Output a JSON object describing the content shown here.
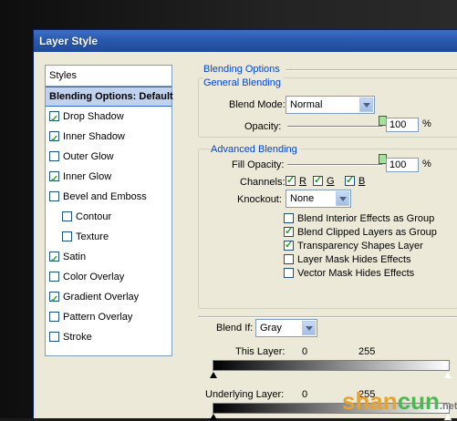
{
  "window": {
    "title": "Layer Style"
  },
  "styles_panel": {
    "header": "Styles",
    "selected": "Blending Options: Default",
    "items": [
      {
        "label": "Drop Shadow",
        "checked": true,
        "sub": false
      },
      {
        "label": "Inner Shadow",
        "checked": true,
        "sub": false
      },
      {
        "label": "Outer Glow",
        "checked": false,
        "sub": false
      },
      {
        "label": "Inner Glow",
        "checked": true,
        "sub": false
      },
      {
        "label": "Bevel and Emboss",
        "checked": false,
        "sub": false
      },
      {
        "label": "Contour",
        "checked": false,
        "sub": true
      },
      {
        "label": "Texture",
        "checked": false,
        "sub": true
      },
      {
        "label": "Satin",
        "checked": true,
        "sub": false
      },
      {
        "label": "Color Overlay",
        "checked": false,
        "sub": false
      },
      {
        "label": "Gradient Overlay",
        "checked": true,
        "sub": false
      },
      {
        "label": "Pattern Overlay",
        "checked": false,
        "sub": false
      },
      {
        "label": "Stroke",
        "checked": false,
        "sub": false
      }
    ]
  },
  "blending_options": {
    "title": "Blending Options",
    "general": {
      "title": "General Blending",
      "blend_mode_label": "Blend Mode:",
      "blend_mode_value": "Normal",
      "opacity_label": "Opacity:",
      "opacity_value": "100",
      "opacity_unit": "%",
      "opacity_fraction": 1.0
    },
    "advanced": {
      "title": "Advanced Blending",
      "fill_opacity_label": "Fill Opacity:",
      "fill_opacity_value": "100",
      "fill_opacity_unit": "%",
      "fill_opacity_fraction": 1.0,
      "channels_label": "Channels:",
      "channels": [
        {
          "label": "R",
          "checked": true
        },
        {
          "label": "G",
          "checked": true
        },
        {
          "label": "B",
          "checked": true
        }
      ],
      "knockout_label": "Knockout:",
      "knockout_value": "None",
      "options": [
        {
          "label": "Blend Interior Effects as Group",
          "checked": false
        },
        {
          "label": "Blend Clipped Layers as Group",
          "checked": true
        },
        {
          "label": "Transparency Shapes Layer",
          "checked": true
        },
        {
          "label": "Layer Mask Hides Effects",
          "checked": false
        },
        {
          "label": "Vector Mask Hides Effects",
          "checked": false
        }
      ]
    },
    "blend_if": {
      "label": "Blend If:",
      "value": "Gray",
      "this_layer_label": "This Layer:",
      "this_layer_min": "0",
      "this_layer_max": "255",
      "underlying_label": "Underlying Layer:",
      "underlying_min": "0",
      "underlying_max": "255"
    }
  },
  "watermark": {
    "text": "shancun",
    "sub": ".net"
  }
}
